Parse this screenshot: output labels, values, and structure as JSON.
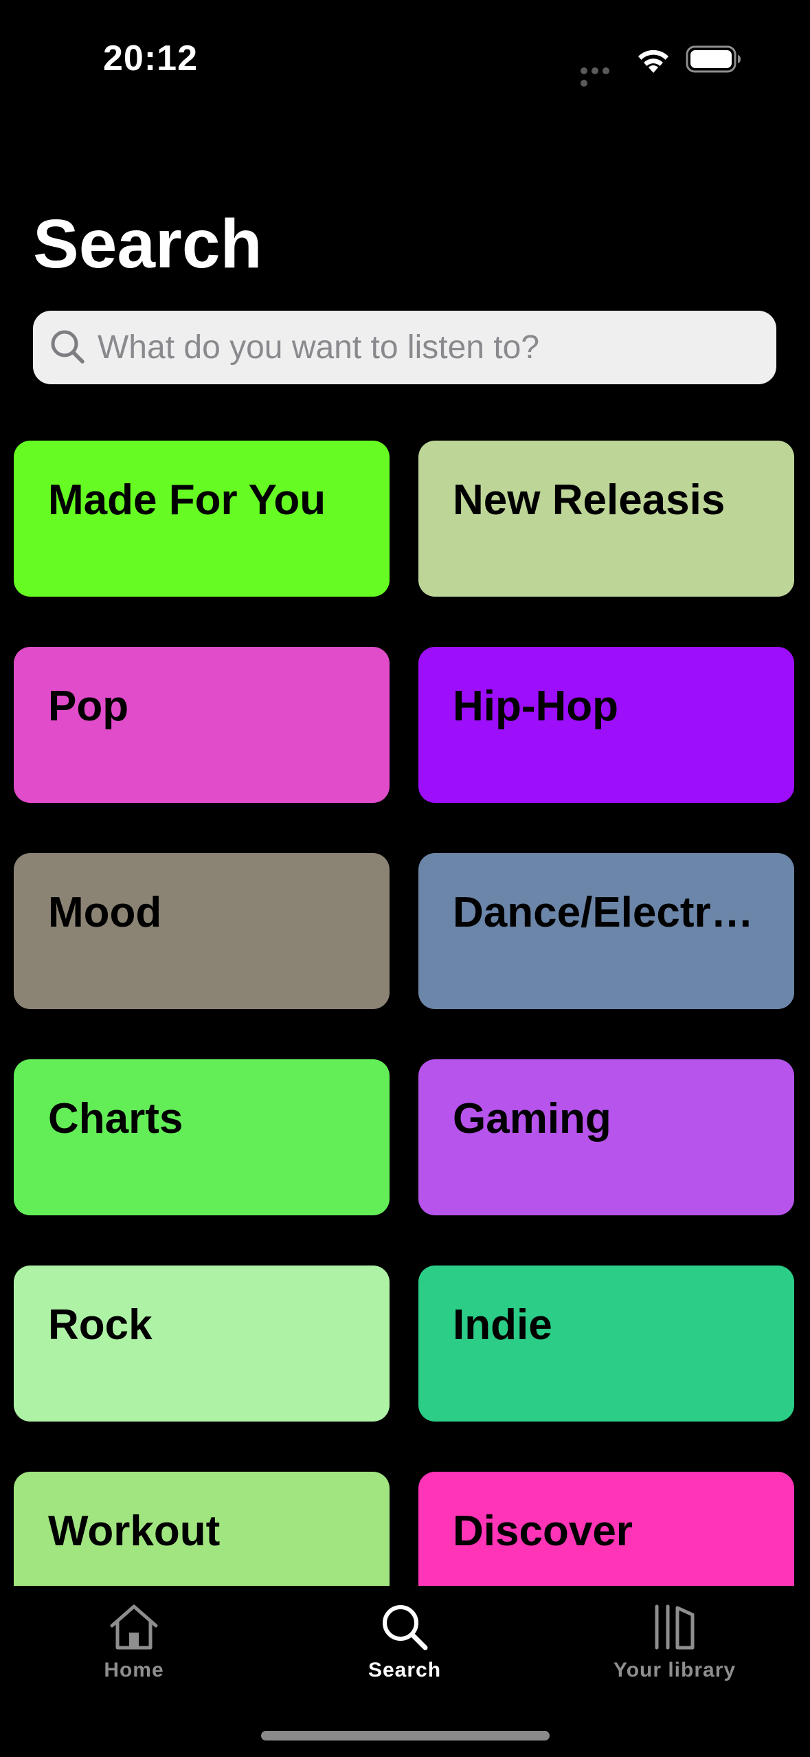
{
  "status_bar": {
    "time": "20:12"
  },
  "page": {
    "title": "Search"
  },
  "search": {
    "placeholder": "What do you want to listen to?",
    "value": ""
  },
  "categories": [
    {
      "label": "Made For You",
      "color": "#66fb22"
    },
    {
      "label": "New Releasis",
      "color": "#bed598"
    },
    {
      "label": "Pop",
      "color": "#e14ccb"
    },
    {
      "label": "Hip-Hop",
      "color": "#9d0efb"
    },
    {
      "label": "Mood",
      "color": "#8b8475"
    },
    {
      "label": "Dance/Electronic",
      "color": "#6c86a9"
    },
    {
      "label": "Charts",
      "color": "#63ee58"
    },
    {
      "label": "Gaming",
      "color": "#b654ec"
    },
    {
      "label": "Rock",
      "color": "#aef2a6"
    },
    {
      "label": "Indie",
      "color": "#2bcd87"
    },
    {
      "label": "Workout",
      "color": "#a0e57f"
    },
    {
      "label": "Discover",
      "color": "#ff34b7"
    }
  ],
  "tab_bar": {
    "tabs": [
      {
        "label": "Home",
        "icon": "house-icon",
        "active": false
      },
      {
        "label": "Search",
        "icon": "search-icon",
        "active": true
      },
      {
        "label": "Your library",
        "icon": "library-icon",
        "active": false
      }
    ]
  }
}
